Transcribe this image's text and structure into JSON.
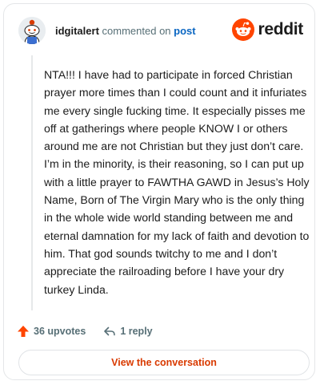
{
  "header": {
    "username": "idgitalert",
    "action_text": "commented on",
    "post_link": "post",
    "brand": "reddit",
    "brand_color": "#ff4500"
  },
  "comment": {
    "body": "NTA!!! I have had to participate in forced Christian prayer more times than I could count and it infuriates me every single fucking time. It especially pisses me off at gatherings where people KNOW I or others around me are not Christian but they just don’t care. I’m in the minority, is their reasoning, so I can put up with a little prayer to FAWTHA GAWD in Jesus’s Holy Name, Born of The Virgin Mary who is the only thing in the whole wide world standing between me and eternal damnation for my lack of faith and devotion to him. That god sounds twitchy to me and I don’t appreciate the railroading before I have your dry turkey Linda."
  },
  "actions": {
    "upvotes": "36 upvotes",
    "replies": "1 reply",
    "upvote_icon": "arrow-up-icon",
    "reply_icon": "reply-arrow-icon"
  },
  "footer": {
    "view_label": "View the conversation"
  }
}
